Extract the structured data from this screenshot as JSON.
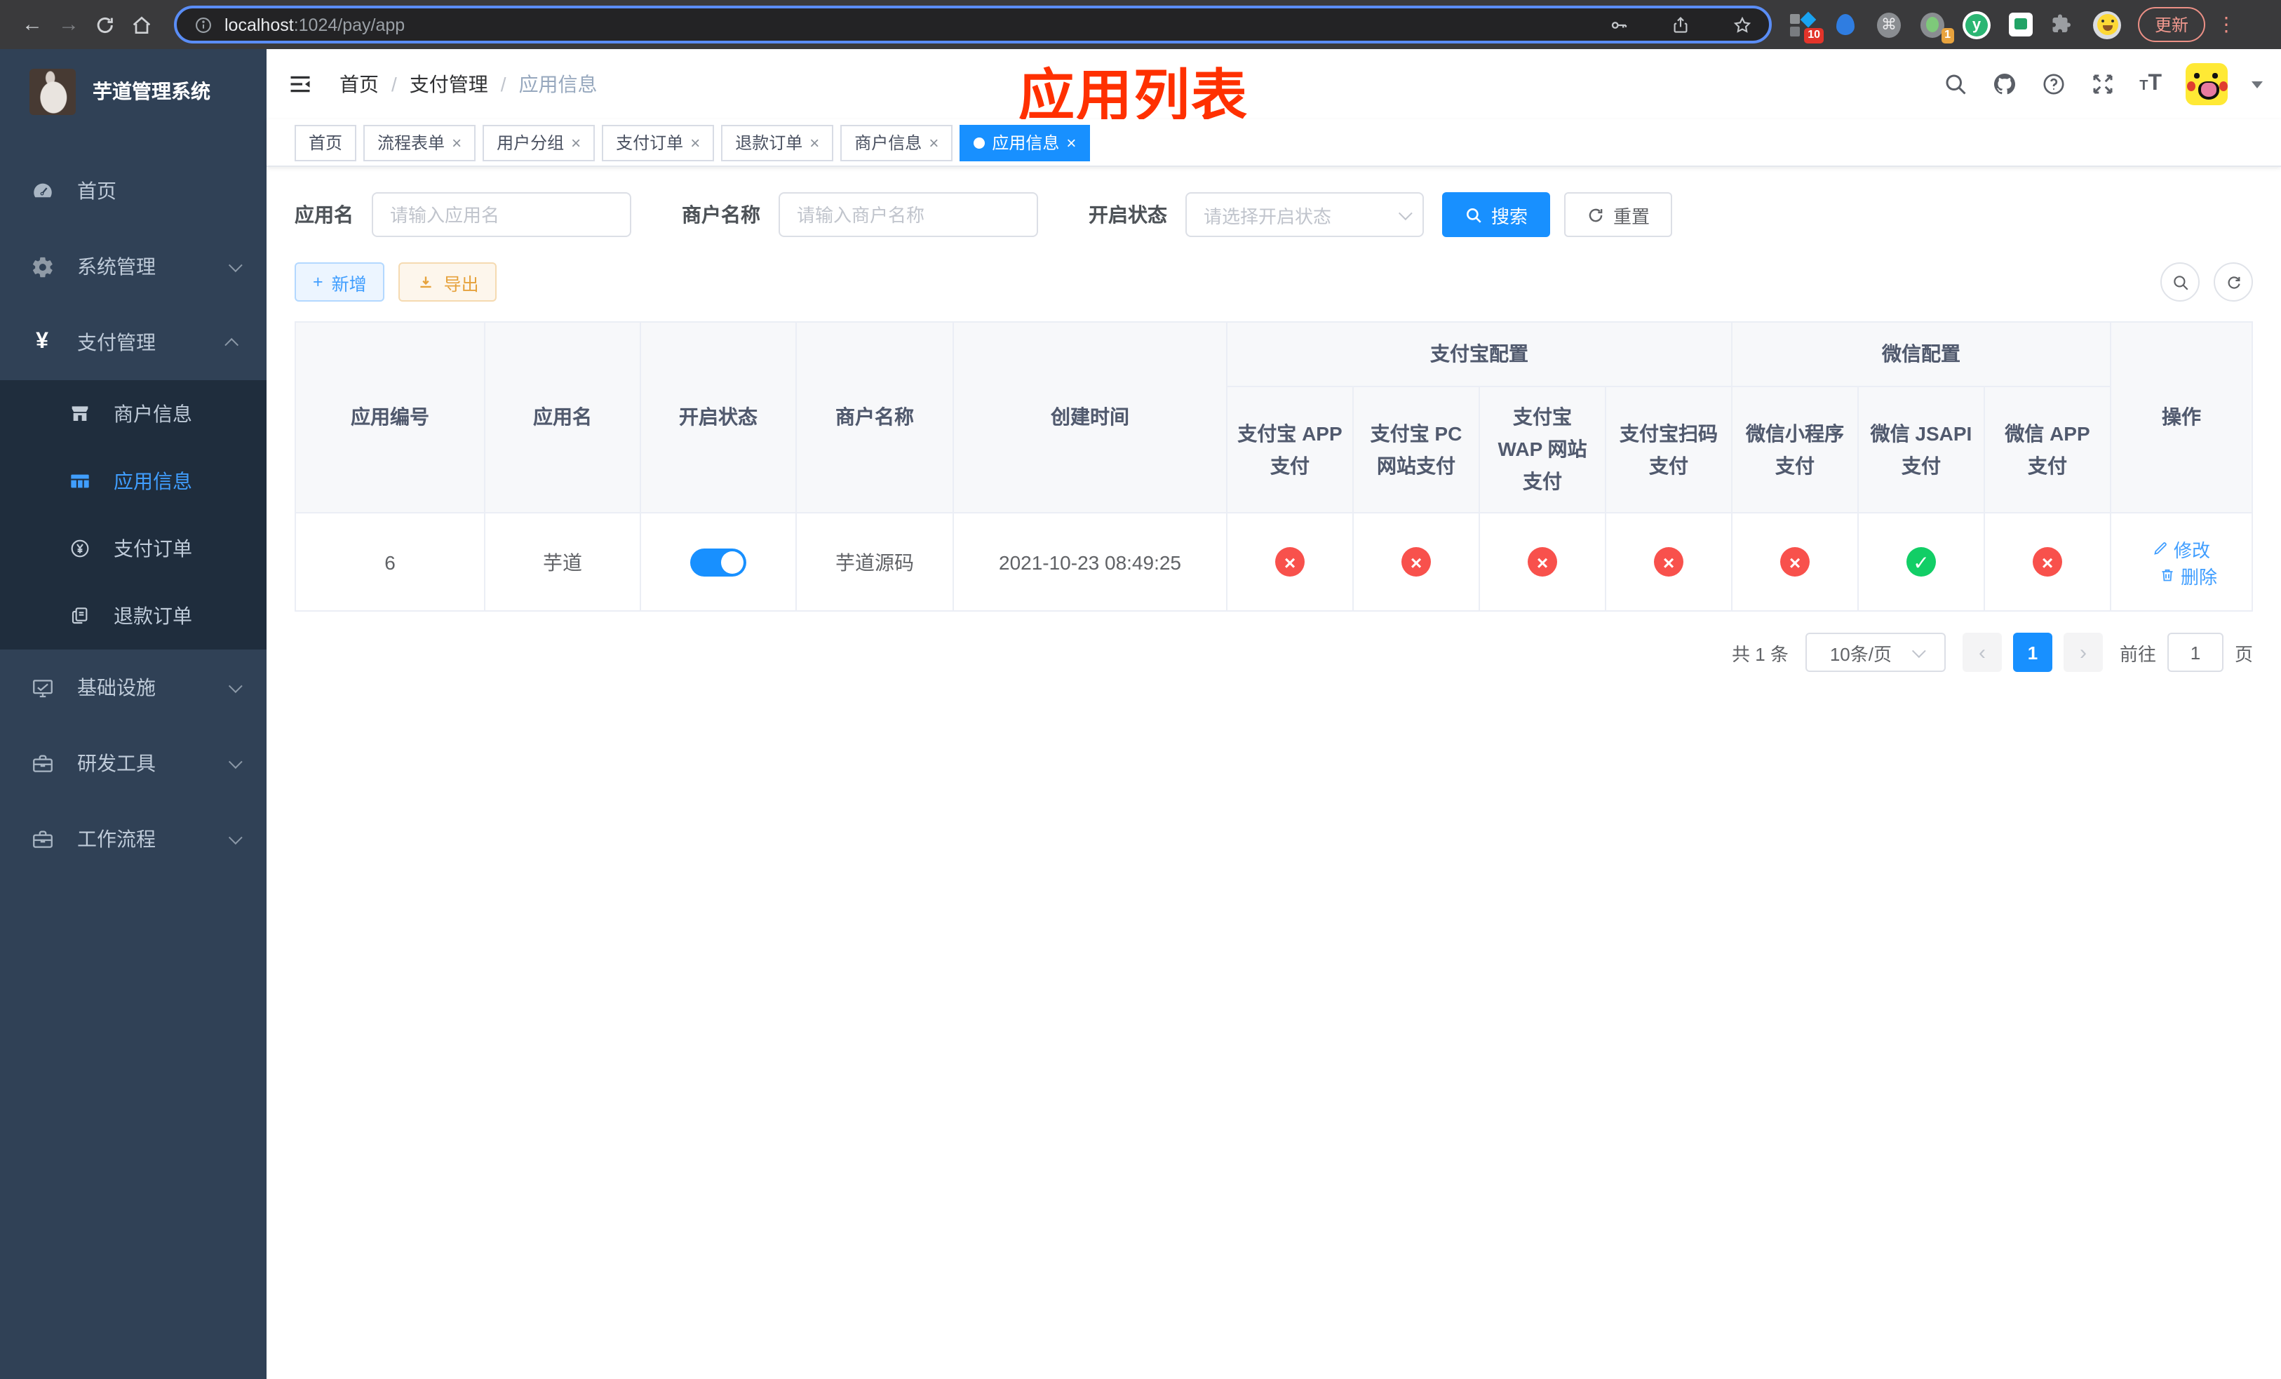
{
  "ui": {
    "close_glyph": "×",
    "prev_glyph": "‹",
    "next_glyph": "›",
    "plus_glyph": "+",
    "cmd_glyph": "⌘",
    "kebab_glyph": "⋮",
    "back_glyph": "←",
    "forward_glyph": "→"
  },
  "browser": {
    "url_host": "localhost",
    "url_rest": ":1024/pay/app",
    "update_label": "更新",
    "ext_badge_count": "10",
    "ext_tab_count": "1",
    "ext_y_letter": "y"
  },
  "sidebar": {
    "title": "芋道管理系统",
    "items": [
      {
        "label": "首页"
      },
      {
        "label": "系统管理"
      },
      {
        "label": "支付管理"
      },
      {
        "label": "商户信息"
      },
      {
        "label": "应用信息"
      },
      {
        "label": "支付订单"
      },
      {
        "label": "退款订单"
      },
      {
        "label": "基础设施"
      },
      {
        "label": "研发工具"
      },
      {
        "label": "工作流程"
      }
    ]
  },
  "header": {
    "breadcrumb": [
      "首页",
      "支付管理",
      "应用信息"
    ],
    "annotation": "应用列表"
  },
  "tabs": [
    {
      "label": "首页",
      "closable": false,
      "active": false
    },
    {
      "label": "流程表单",
      "closable": true,
      "active": false
    },
    {
      "label": "用户分组",
      "closable": true,
      "active": false
    },
    {
      "label": "支付订单",
      "closable": true,
      "active": false
    },
    {
      "label": "退款订单",
      "closable": true,
      "active": false
    },
    {
      "label": "商户信息",
      "closable": true,
      "active": false
    },
    {
      "label": "应用信息",
      "closable": true,
      "active": true
    }
  ],
  "filters": {
    "app_name_label": "应用名",
    "app_name_placeholder": "请输入应用名",
    "merchant_label": "商户名称",
    "merchant_placeholder": "请输入商户名称",
    "status_label": "开启状态",
    "status_placeholder": "请选择开启状态",
    "search_label": "搜索",
    "reset_label": "重置"
  },
  "toolbar": {
    "add_label": "新增",
    "export_label": "导出"
  },
  "table": {
    "columns": {
      "app_id": "应用编号",
      "app_name": "应用名",
      "status": "开启状态",
      "merchant": "商户名称",
      "created": "创建时间",
      "alipay_group": "支付宝配置",
      "wechat_group": "微信配置",
      "op": "操作"
    },
    "sub_columns": [
      "支付宝 APP 支付",
      "支付宝 PC 网站支付",
      "支付宝 WAP 网站支付",
      "支付宝扫码支付",
      "微信小程序支付",
      "微信 JSAPI 支付",
      "微信 APP 支付"
    ],
    "status_icons": {
      "close": "×",
      "check": "✓"
    },
    "row": {
      "id": "6",
      "name": "芋道",
      "enabled": true,
      "merchant": "芋道源码",
      "created": "2021-10-23 08:49:25",
      "pay_statuses": [
        "close",
        "close",
        "close",
        "close",
        "close",
        "check",
        "close"
      ],
      "edit_label": "修改",
      "delete_label": "删除"
    }
  },
  "pagination": {
    "total": "共 1 条",
    "page_size": "10条/页",
    "current": "1",
    "goto_label": "前往",
    "goto_value": "1",
    "unit": "页"
  }
}
